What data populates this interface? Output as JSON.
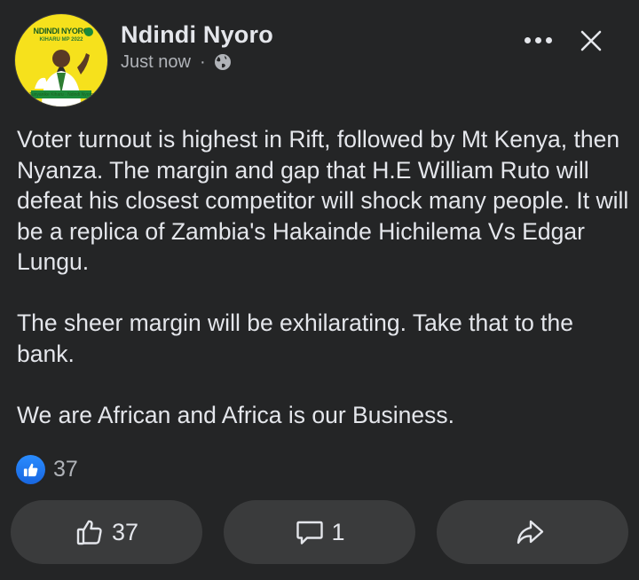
{
  "post": {
    "author": "Ndindi Nyoro",
    "time": "Just now",
    "separator": "·",
    "privacy_icon": "globe-icon",
    "avatar": {
      "top_text": "NDINDI NYORO",
      "sub_text": "KIHARU MP 2022",
      "party": "UDA",
      "bottom_text": "Tunyanike Kiharu · Ndindi Nyoro"
    },
    "paragraphs": [
      "Voter turnout is highest in Rift, followed by Mt Kenya, then Nyanza. The margin and gap that H.E William Ruto will defeat his closest competitor will shock many people. It will be a replica of Zambia's Hakainde Hichilema Vs Edgar Lungu.",
      "The sheer margin will be exhilarating. Take that to the bank.",
      "We are African and Africa is our Business."
    ],
    "reaction_count": "37",
    "reaction_icon": "like-reaction-icon"
  },
  "actions": {
    "like_count": "37",
    "comment_count": "1",
    "share_label": ""
  },
  "colors": {
    "background": "#242526",
    "button_bg": "#3a3b3c",
    "text_primary": "#e4e6eb",
    "text_secondary": "#b0b3b8",
    "like_blue": "#1877f2",
    "avatar_yellow": "#f6e11c"
  }
}
